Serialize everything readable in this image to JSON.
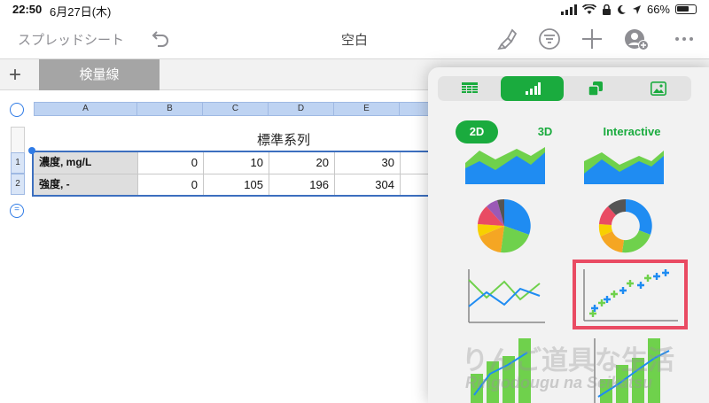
{
  "status_bar": {
    "time": "22:50",
    "date": "6月27日(木)",
    "battery": "66%"
  },
  "toolbar": {
    "back_label": "スプレッドシート",
    "title": "空白"
  },
  "tabs": {
    "active_sheet": "検量線"
  },
  "sheet": {
    "columns": [
      "A",
      "B",
      "C",
      "D",
      "E"
    ],
    "rows": [
      "1",
      "2"
    ],
    "table_title": "標準系列",
    "table": [
      {
        "label": "濃度, mg/L",
        "values": [
          "0",
          "10",
          "20",
          "30"
        ]
      },
      {
        "label": "強度, -",
        "values": [
          "0",
          "105",
          "196",
          "304"
        ]
      }
    ]
  },
  "chart_picker": {
    "segments": [
      {
        "name": "table-icon",
        "active": false
      },
      {
        "name": "bar-chart-icon",
        "active": true
      },
      {
        "name": "shape-icon",
        "active": false
      },
      {
        "name": "media-icon",
        "active": false
      }
    ],
    "subtabs": {
      "two_d": "2D",
      "three_d": "3D",
      "interactive": "Interactive"
    },
    "selected_chart": "scatter",
    "colors": {
      "green": "#1aab3e",
      "blue": "#1f8cf2",
      "light_green": "#6fd14c",
      "highlight": "#e94b63"
    }
  },
  "watermark": {
    "jp": "りんご道具な生活",
    "romaji": "Ringodougu na Seikatsu"
  }
}
